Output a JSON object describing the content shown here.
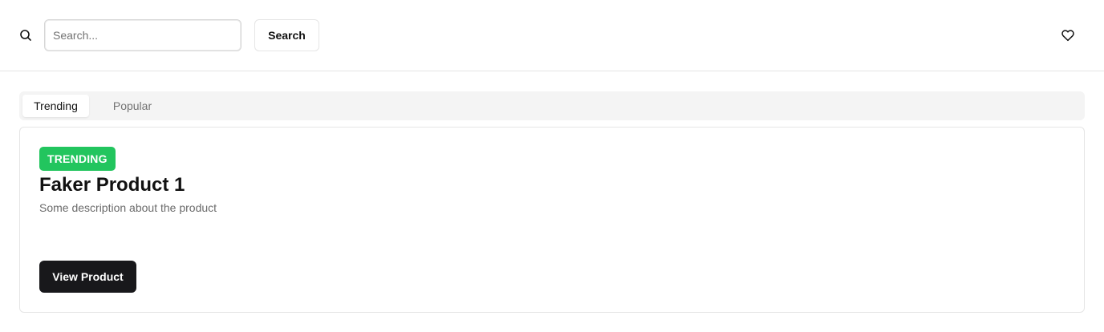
{
  "header": {
    "search_icon": "search-icon",
    "search_placeholder": "Search...",
    "search_value": "",
    "search_button_label": "Search",
    "favorites_icon": "heart-icon"
  },
  "tabs": [
    {
      "label": "Trending",
      "active": true
    },
    {
      "label": "Popular",
      "active": false
    }
  ],
  "product": {
    "badge": "TRENDING",
    "title": "Faker Product 1",
    "description": "Some description about the product",
    "button_label": "View Product"
  },
  "colors": {
    "badge_bg": "#22c55e",
    "primary_button_bg": "#18181b",
    "tabs_bg": "#f4f4f4",
    "border": "#e5e5e5",
    "muted_text": "#737373"
  }
}
